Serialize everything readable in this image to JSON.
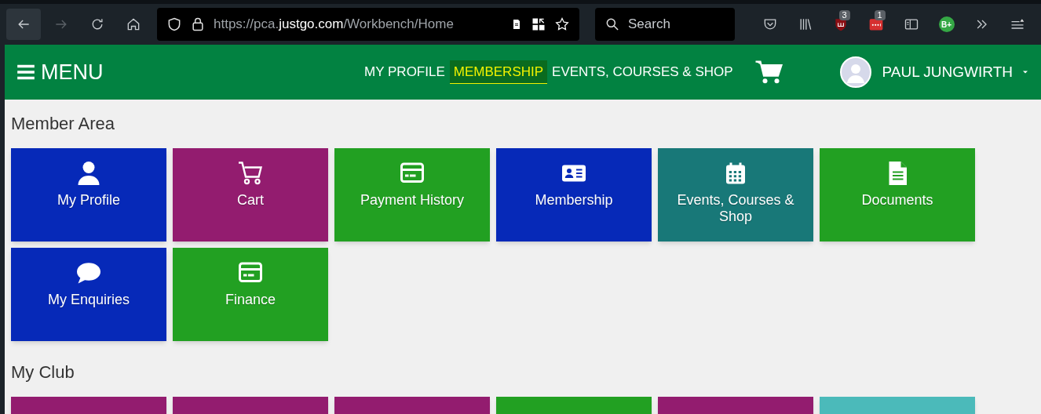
{
  "browser": {
    "url": {
      "prefix": "https://pca.",
      "domain": "justgo.com",
      "path": "/Workbench/Home"
    },
    "search": {
      "placeholder": "Search"
    },
    "extensions": [
      {
        "kind": "pocket"
      },
      {
        "kind": "library"
      },
      {
        "kind": "shield",
        "badge": "3"
      },
      {
        "kind": "dots",
        "badge": "1"
      },
      {
        "kind": "sidebar"
      },
      {
        "kind": "circle",
        "label": "B+"
      },
      {
        "kind": "more"
      },
      {
        "kind": "menu"
      }
    ]
  },
  "header": {
    "menu_label": "MENU",
    "nav": [
      {
        "label": "MY PROFILE",
        "selected": false
      },
      {
        "label": "MEMBERSHIP",
        "selected": true
      },
      {
        "label": "EVENTS, COURSES & SHOP",
        "selected": false
      }
    ],
    "user": "PAUL JUNGWIRTH"
  },
  "sections": [
    {
      "title": "Member Area",
      "tiles": [
        {
          "label": "My Profile",
          "kind": "profile",
          "color": "#0629b8"
        },
        {
          "label": "Cart",
          "kind": "cart",
          "color": "#931c6f"
        },
        {
          "label": "Payment History",
          "kind": "card",
          "color": "#22a022"
        },
        {
          "label": "Membership",
          "kind": "idcard",
          "color": "#0629b8"
        },
        {
          "label": "Events, Courses & Shop",
          "kind": "calendar",
          "color": "#187878"
        },
        {
          "label": "Documents",
          "kind": "document",
          "color": "#22a022"
        },
        {
          "label": "My Enquiries",
          "kind": "chat",
          "color": "#0629b8"
        },
        {
          "label": "Finance",
          "kind": "card",
          "color": "#22a022"
        }
      ]
    },
    {
      "title": "My Club",
      "tiles": [
        {
          "color": "#931c6f"
        },
        {
          "color": "#931c6f"
        },
        {
          "color": "#931c6f"
        },
        {
          "color": "#22a022"
        },
        {
          "color": "#931c6f"
        },
        {
          "color": "#4bbaba"
        }
      ]
    }
  ]
}
